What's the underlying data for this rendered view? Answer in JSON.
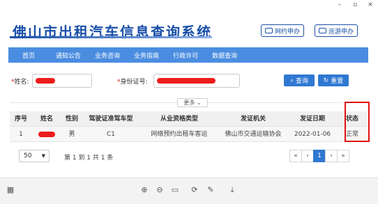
{
  "window": {
    "minimize": "–",
    "maximize": "▫",
    "close": "×"
  },
  "header": {
    "title": "佛山市出租汽车信息查询系统",
    "btn_network": "网约申办",
    "btn_cruise": "巡游申办"
  },
  "nav": [
    "首页",
    "通知公告",
    "业务咨询",
    "业务指南",
    "行政许可",
    "数据查询"
  ],
  "search": {
    "name_label": "姓名:",
    "id_label": "身份证号:",
    "required_mark": "*",
    "query_btn": "查询",
    "reset_btn": "重置",
    "more_btn": "更多 ⌄"
  },
  "table": {
    "headers": [
      "序号",
      "姓名",
      "性别",
      "驾驶证准驾车型",
      "从业资格类型",
      "发证机关",
      "发证日期",
      "状态"
    ],
    "rows": [
      [
        "1",
        "",
        "男",
        "C1",
        "网络预约出租车客运",
        "佛山市交通运输协会",
        "2022-01-06",
        "正常"
      ]
    ]
  },
  "pagination": {
    "page_size": "50",
    "info": "第 1 到 1 共 1 条",
    "first": "«",
    "prev": "‹",
    "current": "1",
    "next": "›",
    "last": "»"
  },
  "colors": {
    "accent": "#2f78d2",
    "nav": "#4a8de0",
    "title": "#1a4fa8",
    "highlight": "#e01010",
    "redaction": "#ee1c1c"
  },
  "toolbar_icons": [
    "grid-icon",
    "zoom-in-icon",
    "zoom-out-icon",
    "fit-page-icon",
    "rotate-icon",
    "edit-icon",
    "download-icon"
  ]
}
